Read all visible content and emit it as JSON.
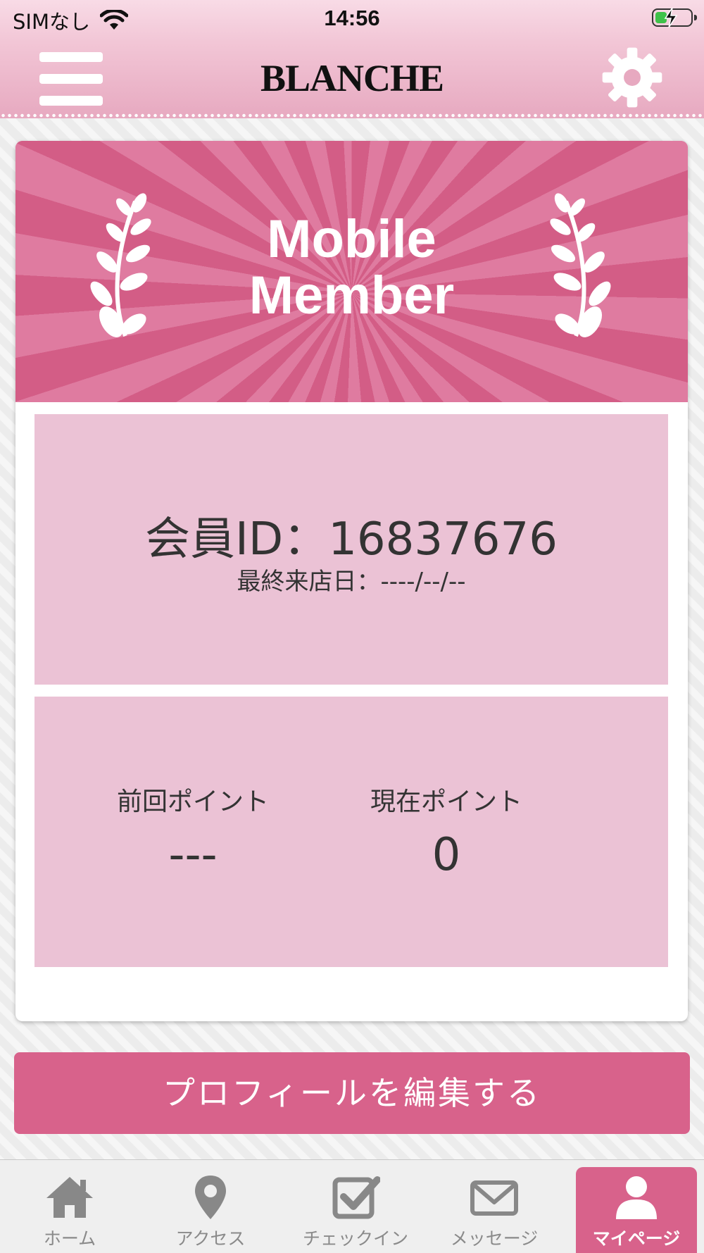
{
  "status_bar": {
    "carrier": "SIMなし",
    "time": "14:56",
    "battery_level": 0.35
  },
  "header": {
    "title": "BLANCHE"
  },
  "card": {
    "banner_line1": "Mobile",
    "banner_line2": "Member",
    "member_id": "会員ID：16837676",
    "last_visit": "最終来店日：----/--/--",
    "previous_points_label": "前回ポイント",
    "previous_points_value": "---",
    "current_points_label": "現在ポイント",
    "current_points_value": "0"
  },
  "edit_profile_button": "プロフィールを編集する",
  "tabs": [
    {
      "label": "ホーム",
      "icon": "home-icon"
    },
    {
      "label": "アクセス",
      "icon": "map-pin-icon"
    },
    {
      "label": "チェックイン",
      "icon": "checkbox-icon"
    },
    {
      "label": "メッセージ",
      "icon": "envelope-icon"
    },
    {
      "label": "マイページ",
      "icon": "person-icon",
      "active": true
    }
  ],
  "colors": {
    "accent": "#d8628b",
    "panel": "#ebc2d5",
    "header": "#f2c6d6"
  }
}
